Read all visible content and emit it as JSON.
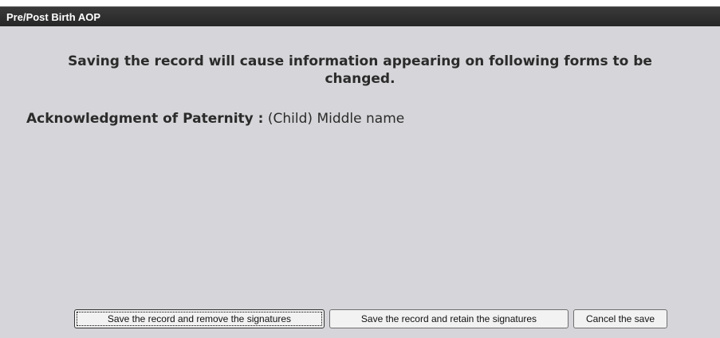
{
  "dialog": {
    "title": "Pre/Post Birth AOP",
    "message_line1": "Saving the record will cause information appearing on following forms to be",
    "message_line2": "changed.",
    "affected_form": "Acknowledgment of Paternity :",
    "affected_field": "(Child) Middle name"
  },
  "buttons": {
    "save_remove": "Save the record and remove the signatures",
    "save_retain": "Save the record and retain the signatures",
    "cancel": "Cancel the save"
  }
}
